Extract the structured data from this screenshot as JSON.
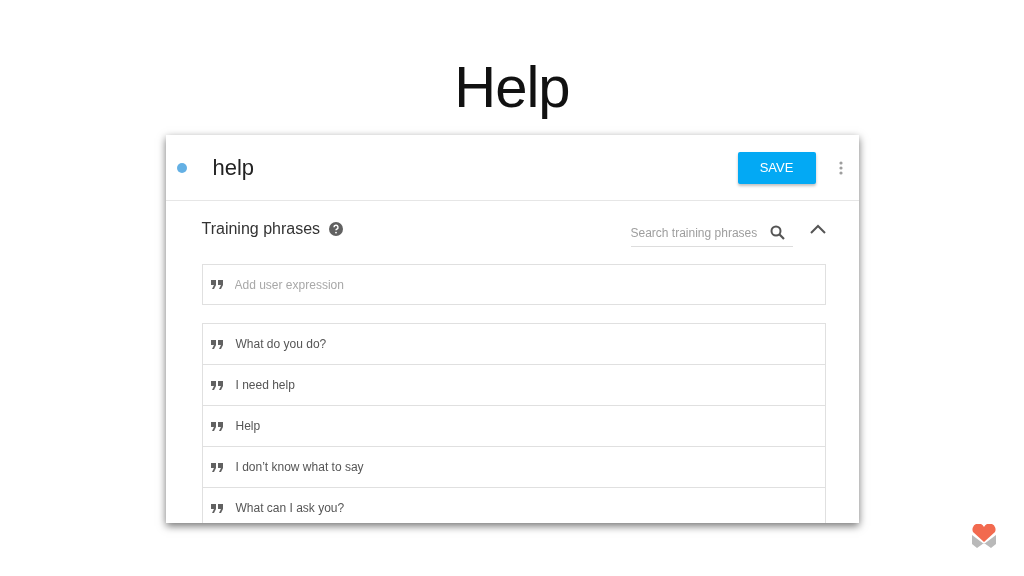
{
  "slide_title": "Help",
  "intent": {
    "name": "help",
    "color": "#64b0e4",
    "save_label": "SAVE"
  },
  "training_phrases": {
    "heading": "Training phrases",
    "search": {
      "placeholder": "Search training phrases"
    },
    "expanded": true,
    "add_field": {
      "placeholder": "Add user expression"
    },
    "phrases": [
      {
        "text": "What do you do?"
      },
      {
        "text": "I need help"
      },
      {
        "text": "Help"
      },
      {
        "text": "I don’t know what to say"
      },
      {
        "text": "What can I ask you?"
      }
    ]
  }
}
